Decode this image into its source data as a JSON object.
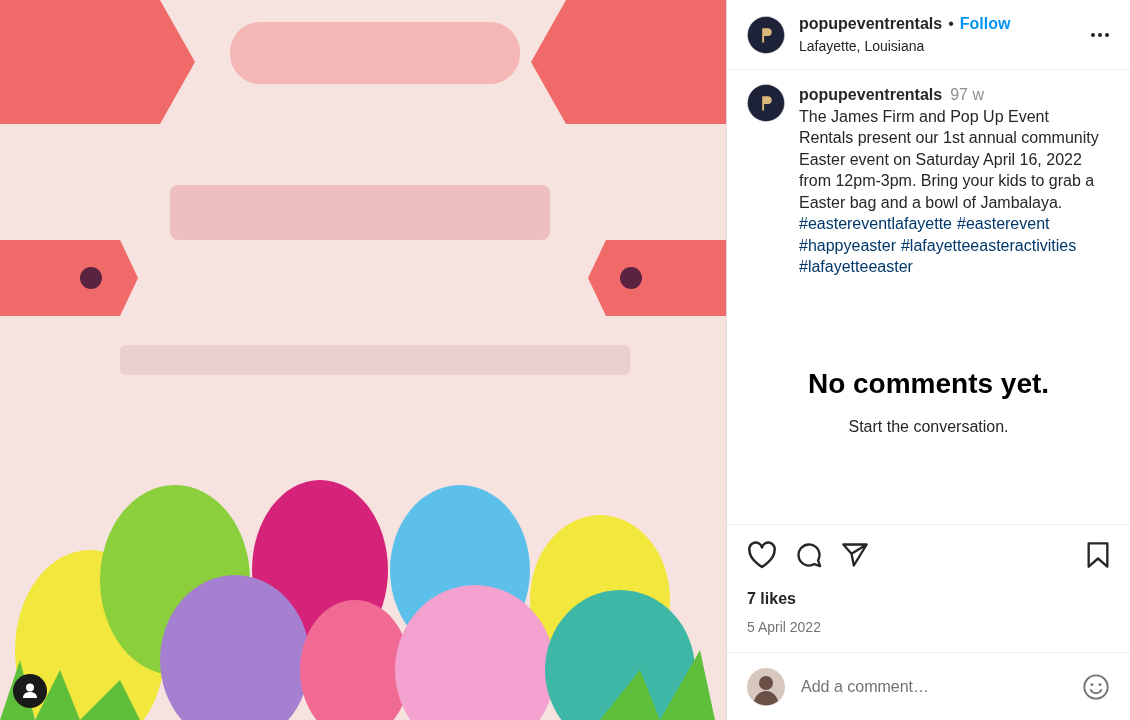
{
  "post": {
    "image": {
      "tagged": true
    },
    "author": {
      "username": "popupeventrentals",
      "separator": "•",
      "follow": "Follow",
      "location": "Lafayette, Louisiana"
    },
    "caption": {
      "username": "popupeventrentals",
      "age": "97 w",
      "text": "The James Firm and Pop Up Event Rentals present our 1st annual community Easter event on Saturday April 16, 2022 from 12pm-3pm. Bring your kids to grab a Easter bag and a bowl of Jambalaya.",
      "hashtags": [
        "#eastereventlafayette",
        "#easterevent",
        "#happyeaster",
        "#lafayetteeasteractivities",
        "#lafayetteeaster"
      ]
    },
    "comments": {
      "empty_title": "No comments yet.",
      "empty_hint": "Start the conversation."
    },
    "actions": {
      "liked": false,
      "saved": false
    },
    "likes": "7 likes",
    "date": "5 April 2022",
    "comment_box": {
      "placeholder": "Add a comment…"
    }
  }
}
